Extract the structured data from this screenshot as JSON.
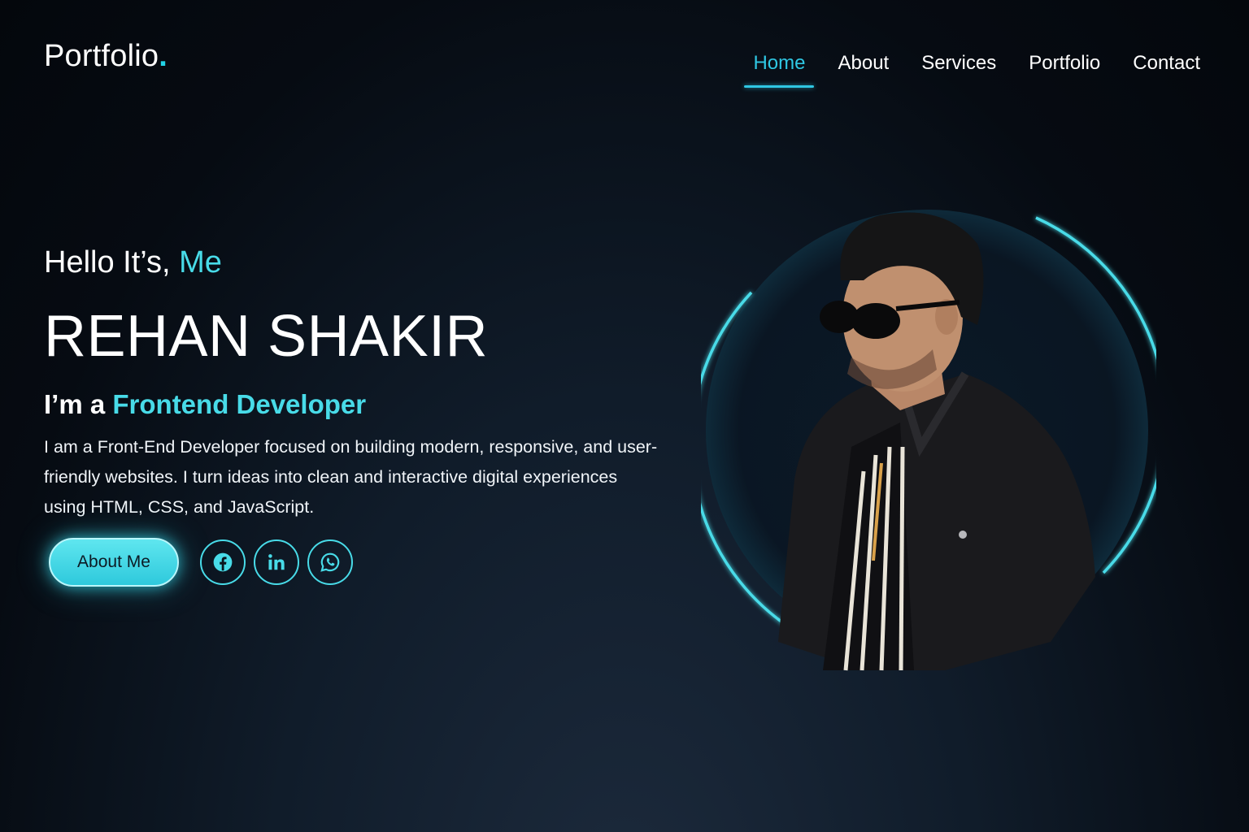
{
  "header": {
    "logo_text": "Portfolio",
    "logo_dot": ".",
    "nav": [
      {
        "label": "Home",
        "active": true
      },
      {
        "label": "About",
        "active": false
      },
      {
        "label": "Services",
        "active": false
      },
      {
        "label": "Portfolio",
        "active": false
      },
      {
        "label": "Contact",
        "active": false
      }
    ]
  },
  "hero": {
    "greeting_prefix": "Hello It’s, ",
    "greeting_accent": "Me",
    "name": "REHAN SHAKIR",
    "role_prefix": "I’m a ",
    "role_accent": "Frontend Developer",
    "description": "I am a Front-End Developer focused on building modern, responsive, and user-friendly websites. I turn ideas into clean and interactive digital experiences using HTML, CSS, and JavaScript.",
    "cta_label": "About Me",
    "socials": [
      {
        "icon": "facebook-icon"
      },
      {
        "icon": "linkedin-icon"
      },
      {
        "icon": "whatsapp-icon"
      }
    ]
  },
  "colors": {
    "accent": "#48dbe8",
    "nav_active": "#2fc7e3",
    "background": "#060b12"
  }
}
